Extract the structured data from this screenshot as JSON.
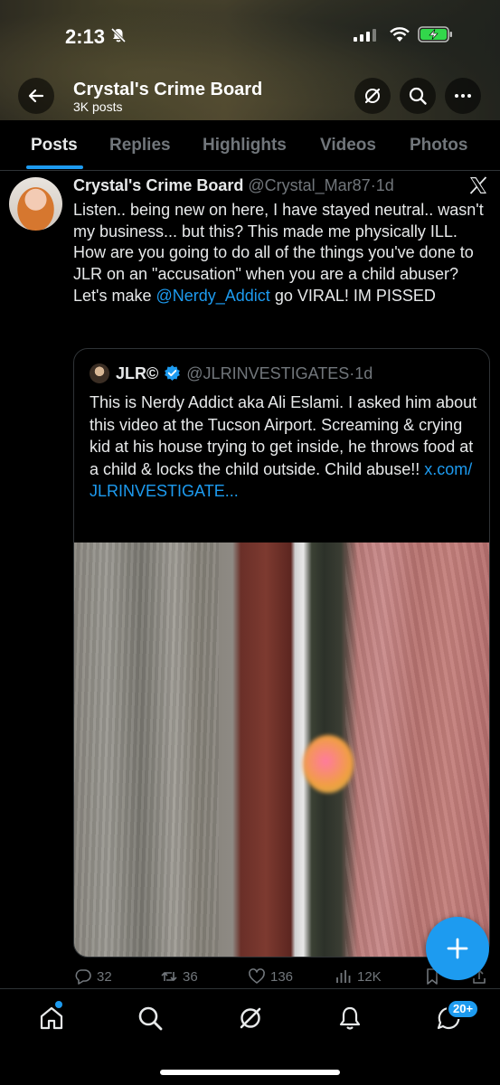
{
  "status_bar": {
    "time": "2:13"
  },
  "header": {
    "profile_name": "Crystal's Crime Board",
    "post_count": "3K posts"
  },
  "tabs": [
    {
      "label": "Posts",
      "active": true
    },
    {
      "label": "Replies"
    },
    {
      "label": "Highlights"
    },
    {
      "label": "Videos"
    },
    {
      "label": "Photos"
    }
  ],
  "tweet": {
    "author_name": "Crystal's Crime Board",
    "handle": "@Crystal_Mar87",
    "age": "1d",
    "text_before": "Listen.. being new on here, I have stayed neutral.. wasn't my business... but this? This made me physically ILL. How are you going to do all of the things you've done to JLR on an \"accusation\" when you are a child abuser? Let's make ",
    "mention": "@Nerdy_Addict",
    "text_after": " go VIRAL! IM PISSED",
    "quote": {
      "author_name": "JLR©",
      "handle": "@JLRINVESTIGATES",
      "age": "1d",
      "text": "This is Nerdy Addict aka Ali Eslami. I asked him about this video at the Tucson Airport. Screaming & crying kid at his house trying to get inside, he throws food at a child & locks the child outside. Child abuse!! ",
      "link": "x.com/ JLRINVESTIGATE..."
    },
    "stats": {
      "replies": "32",
      "reposts": "36",
      "likes": "136",
      "views": "12K"
    }
  },
  "bottom_nav": {
    "messages_badge": "20+"
  },
  "colors": {
    "accent": "#1d9bf0",
    "muted": "#71767b",
    "text": "#e7e9ea"
  }
}
